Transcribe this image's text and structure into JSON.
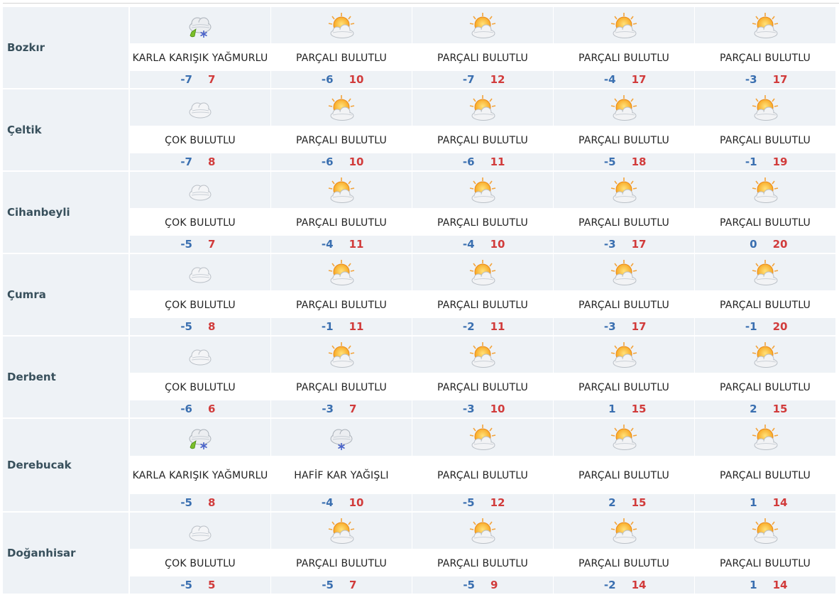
{
  "rows": [
    {
      "city": "Bozkır",
      "days": [
        {
          "icon": "sleet-icon",
          "desc": "KARLA KARIŞIK YAĞMURLU",
          "min": "-7",
          "max": "7"
        },
        {
          "icon": "partly-cloudy-icon",
          "desc": "PARÇALI BULUTLU",
          "min": "-6",
          "max": "10"
        },
        {
          "icon": "partly-cloudy-icon",
          "desc": "PARÇALI BULUTLU",
          "min": "-7",
          "max": "12"
        },
        {
          "icon": "partly-cloudy-icon",
          "desc": "PARÇALI BULUTLU",
          "min": "-4",
          "max": "17"
        },
        {
          "icon": "partly-cloudy-icon",
          "desc": "PARÇALI BULUTLU",
          "min": "-3",
          "max": "17"
        }
      ]
    },
    {
      "city": "Çeltik",
      "days": [
        {
          "icon": "cloudy-icon",
          "desc": "ÇOK BULUTLU",
          "min": "-7",
          "max": "8"
        },
        {
          "icon": "partly-cloudy-icon",
          "desc": "PARÇALI BULUTLU",
          "min": "-6",
          "max": "10"
        },
        {
          "icon": "partly-cloudy-icon",
          "desc": "PARÇALI BULUTLU",
          "min": "-6",
          "max": "11"
        },
        {
          "icon": "partly-cloudy-icon",
          "desc": "PARÇALI BULUTLU",
          "min": "-5",
          "max": "18"
        },
        {
          "icon": "partly-cloudy-icon",
          "desc": "PARÇALI BULUTLU",
          "min": "-1",
          "max": "19"
        }
      ]
    },
    {
      "city": "Cihanbeyli",
      "days": [
        {
          "icon": "cloudy-icon",
          "desc": "ÇOK BULUTLU",
          "min": "-5",
          "max": "7"
        },
        {
          "icon": "partly-cloudy-icon",
          "desc": "PARÇALI BULUTLU",
          "min": "-4",
          "max": "11"
        },
        {
          "icon": "partly-cloudy-icon",
          "desc": "PARÇALI BULUTLU",
          "min": "-4",
          "max": "10"
        },
        {
          "icon": "partly-cloudy-icon",
          "desc": "PARÇALI BULUTLU",
          "min": "-3",
          "max": "17"
        },
        {
          "icon": "partly-cloudy-icon",
          "desc": "PARÇALI BULUTLU",
          "min": "0",
          "max": "20"
        }
      ]
    },
    {
      "city": "Çumra",
      "days": [
        {
          "icon": "cloudy-icon",
          "desc": "ÇOK BULUTLU",
          "min": "-5",
          "max": "8"
        },
        {
          "icon": "partly-cloudy-icon",
          "desc": "PARÇALI BULUTLU",
          "min": "-1",
          "max": "11"
        },
        {
          "icon": "partly-cloudy-icon",
          "desc": "PARÇALI BULUTLU",
          "min": "-2",
          "max": "11"
        },
        {
          "icon": "partly-cloudy-icon",
          "desc": "PARÇALI BULUTLU",
          "min": "-3",
          "max": "17"
        },
        {
          "icon": "partly-cloudy-icon",
          "desc": "PARÇALI BULUTLU",
          "min": "-1",
          "max": "20"
        }
      ]
    },
    {
      "city": "Derbent",
      "days": [
        {
          "icon": "cloudy-icon",
          "desc": "ÇOK BULUTLU",
          "min": "-6",
          "max": "6"
        },
        {
          "icon": "partly-cloudy-icon",
          "desc": "PARÇALI BULUTLU",
          "min": "-3",
          "max": "7"
        },
        {
          "icon": "partly-cloudy-icon",
          "desc": "PARÇALI BULUTLU",
          "min": "-3",
          "max": "10"
        },
        {
          "icon": "partly-cloudy-icon",
          "desc": "PARÇALI BULUTLU",
          "min": "1",
          "max": "15"
        },
        {
          "icon": "partly-cloudy-icon",
          "desc": "PARÇALI BULUTLU",
          "min": "2",
          "max": "15"
        }
      ]
    },
    {
      "city": "Derebucak",
      "days": [
        {
          "icon": "sleet-icon",
          "desc": "KARLA KARIŞIK YAĞMURLU",
          "min": "-5",
          "max": "8"
        },
        {
          "icon": "light-snow-icon",
          "desc": "HAFİF KAR YAĞIŞLI",
          "min": "-4",
          "max": "10"
        },
        {
          "icon": "partly-cloudy-icon",
          "desc": "PARÇALI BULUTLU",
          "min": "-5",
          "max": "12"
        },
        {
          "icon": "partly-cloudy-icon",
          "desc": "PARÇALI BULUTLU",
          "min": "2",
          "max": "15"
        },
        {
          "icon": "partly-cloudy-icon",
          "desc": "PARÇALI BULUTLU",
          "min": "1",
          "max": "14"
        }
      ]
    },
    {
      "city": "Doğanhisar",
      "days": [
        {
          "icon": "cloudy-icon",
          "desc": "ÇOK BULUTLU",
          "min": "-5",
          "max": "5"
        },
        {
          "icon": "partly-cloudy-icon",
          "desc": "PARÇALI BULUTLU",
          "min": "-5",
          "max": "7"
        },
        {
          "icon": "partly-cloudy-icon",
          "desc": "PARÇALI BULUTLU",
          "min": "-5",
          "max": "9"
        },
        {
          "icon": "partly-cloudy-icon",
          "desc": "PARÇALI BULUTLU",
          "min": "-2",
          "max": "14"
        },
        {
          "icon": "partly-cloudy-icon",
          "desc": "PARÇALI BULUTLU",
          "min": "1",
          "max": "14"
        }
      ]
    }
  ],
  "colors": {
    "min_temp": "#3a6fb0",
    "max_temp": "#d13b3b",
    "city_text": "#38505c",
    "row_bg": "#eef2f6"
  }
}
